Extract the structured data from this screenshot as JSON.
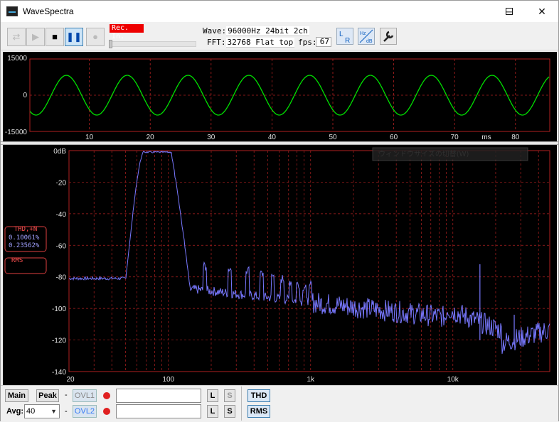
{
  "window": {
    "title": "WaveSpectra"
  },
  "toolbar": {
    "rec_label": "Rec. In.",
    "wave_label": "Wave:",
    "wave_value": "96000Hz 24bit 2ch",
    "fft_label": "FFT:",
    "fft_value": "32768 Flat top",
    "fps_label": "fps:",
    "fps_value": "67"
  },
  "wave_chart": {
    "y_ticks": [
      "15000",
      "0",
      "-15000"
    ],
    "x_ticks": [
      "10",
      "20",
      "30",
      "40",
      "50",
      "60",
      "70",
      "80"
    ],
    "x_unit": "ms"
  },
  "spectrum": {
    "y_ticks": [
      "0dB",
      "-20",
      "-40",
      "-60",
      "-80",
      "-100",
      "-120",
      "-140"
    ],
    "x_ticks": [
      "20",
      "100",
      "1k",
      "10k"
    ],
    "thd_label": "THD,+N",
    "thd_l": "0.10061%",
    "thd_r": "0.23562%",
    "rms_label": "RMS",
    "tooltip": "ウィンドウサイズの切替(W)"
  },
  "bottom": {
    "main_label": "Main",
    "peak_label": "Peak",
    "dash": "-",
    "ovl1_label": "OVL1",
    "ovl2_label": "OVL2",
    "avg_label": "Avg:",
    "avg_value": "40",
    "l_label": "L",
    "s_label": "S",
    "thd_button": "THD",
    "rms_button": "RMS"
  },
  "colors": {
    "wave": "#00e000",
    "spectrum": "#7878ff",
    "grid": "#b02020",
    "rec": "#ee0000"
  }
}
